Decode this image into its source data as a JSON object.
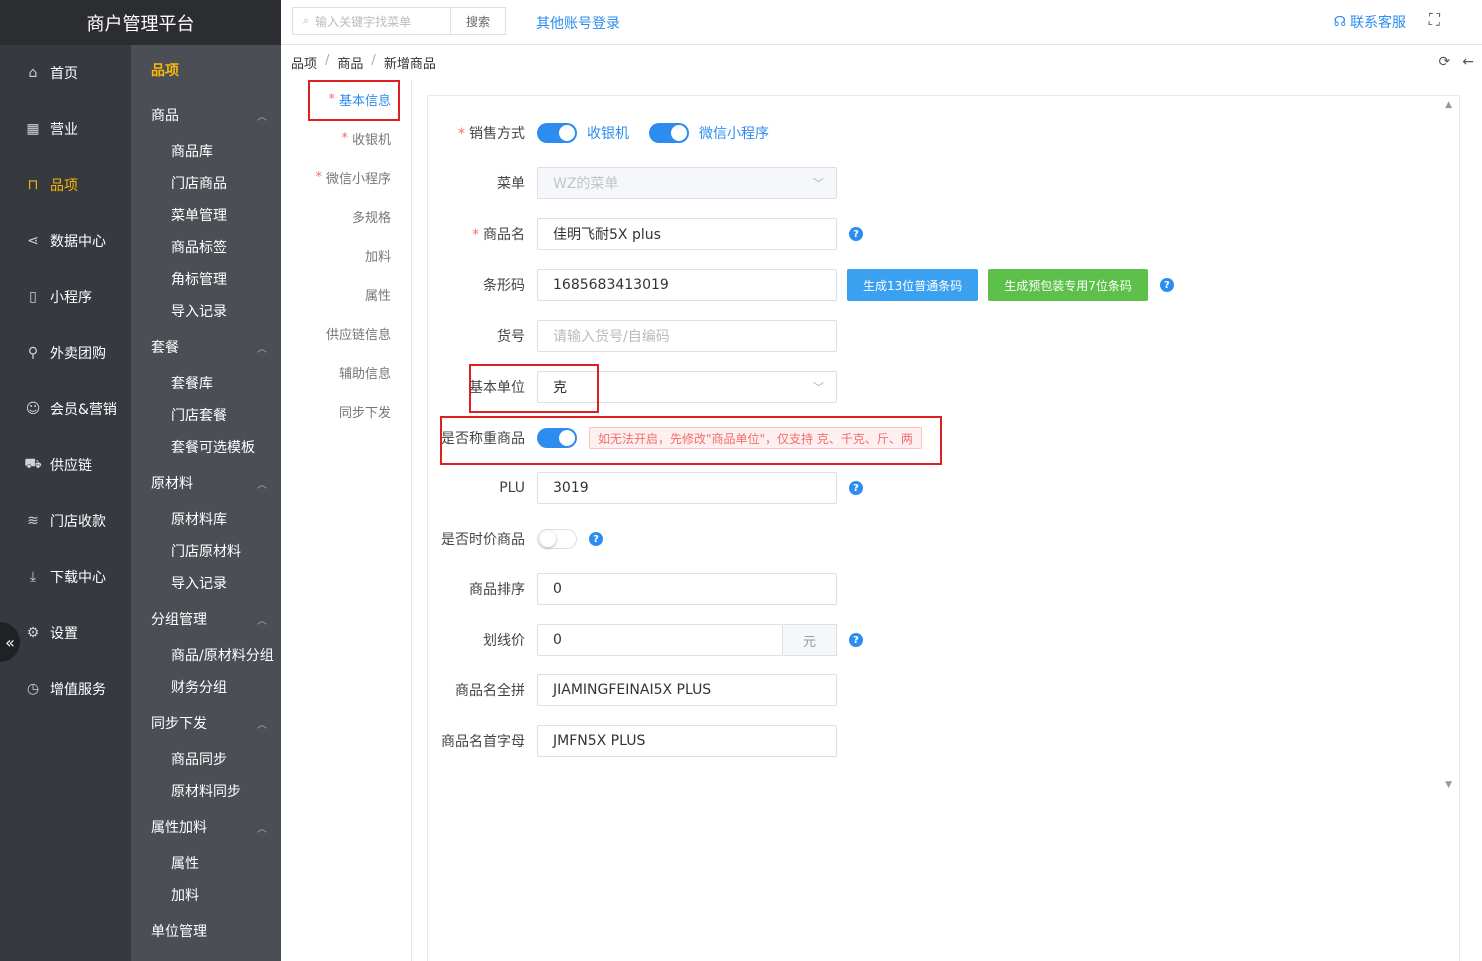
{
  "app": {
    "title": "商户管理平台"
  },
  "nav": [
    {
      "label": "首页",
      "icon": "home-icon"
    },
    {
      "label": "营业",
      "icon": "calendar-icon"
    },
    {
      "label": "品项",
      "icon": "bag-icon",
      "active": true
    },
    {
      "label": "数据中心",
      "icon": "share-icon"
    },
    {
      "label": "小程序",
      "icon": "phone-icon"
    },
    {
      "label": "外卖团购",
      "icon": "bike-icon"
    },
    {
      "label": "会员&营销",
      "icon": "user-icon"
    },
    {
      "label": "供应链",
      "icon": "truck-icon"
    },
    {
      "label": "门店收款",
      "icon": "coins-icon"
    },
    {
      "label": "下载中心",
      "icon": "download-icon"
    },
    {
      "label": "设置",
      "icon": "gear-icon"
    },
    {
      "label": "增值服务",
      "icon": "clock-icon"
    }
  ],
  "subnav": {
    "head": "品项",
    "groups": [
      {
        "label": "商品",
        "items": [
          "商品库",
          "门店商品",
          "菜单管理",
          "商品标签",
          "角标管理",
          "导入记录"
        ]
      },
      {
        "label": "套餐",
        "items": [
          "套餐库",
          "门店套餐",
          "套餐可选模板"
        ]
      },
      {
        "label": "原材料",
        "items": [
          "原材料库",
          "门店原材料",
          "导入记录"
        ]
      },
      {
        "label": "分组管理",
        "items": [
          "商品/原材料分组",
          "财务分组"
        ]
      },
      {
        "label": "同步下发",
        "items": [
          "商品同步",
          "原材料同步"
        ]
      },
      {
        "label": "属性加料",
        "items": [
          "属性",
          "加料"
        ]
      },
      {
        "label": "单位管理",
        "items": []
      }
    ]
  },
  "topbar": {
    "search_placeholder": "输入关键字找菜单",
    "search_button": "搜索",
    "other_login": "其他账号登录",
    "contact": "联系客服"
  },
  "breadcrumb": [
    "品项",
    "商品",
    "新增商品"
  ],
  "tabs": [
    {
      "label": "基本信息",
      "required": true,
      "active": true
    },
    {
      "label": "收银机",
      "required": true
    },
    {
      "label": "微信小程序",
      "required": true
    },
    {
      "label": "多规格",
      "required": false
    },
    {
      "label": "加料",
      "required": false
    },
    {
      "label": "属性",
      "required": false
    },
    {
      "label": "供应链信息",
      "required": false
    },
    {
      "label": "辅助信息",
      "required": false
    },
    {
      "label": "同步下发",
      "required": false
    }
  ],
  "form": {
    "sale_mode": {
      "label": "销售方式",
      "option1": "收银机",
      "option2": "微信小程序"
    },
    "menu": {
      "label": "菜单",
      "value": "WZ的菜单"
    },
    "name": {
      "label": "商品名",
      "value": "佳明飞耐5X plus"
    },
    "barcode": {
      "label": "条形码",
      "value": "1685683413019",
      "btn1": "生成13位普通条码",
      "btn2": "生成预包装专用7位条码"
    },
    "sku": {
      "label": "货号",
      "placeholder": "请输入货号/自编码"
    },
    "unit": {
      "label": "基本单位",
      "value": "克"
    },
    "weighed": {
      "label": "是否称重商品",
      "warning": "如无法开启，先修改\"商品单位\"，仅支持 克、千克、斤、两"
    },
    "plu": {
      "label": "PLU",
      "value": "3019"
    },
    "seasonal": {
      "label": "是否时价商品"
    },
    "sort": {
      "label": "商品排序",
      "value": "0"
    },
    "strike": {
      "label": "划线价",
      "value": "0",
      "suffix": "元"
    },
    "pinyin": {
      "label": "商品名全拼",
      "value": "JIAMINGFEINAI5X PLUS"
    },
    "initials": {
      "label": "商品名首字母",
      "value": "JMFN5X PLUS"
    }
  },
  "help_glyph": "?"
}
